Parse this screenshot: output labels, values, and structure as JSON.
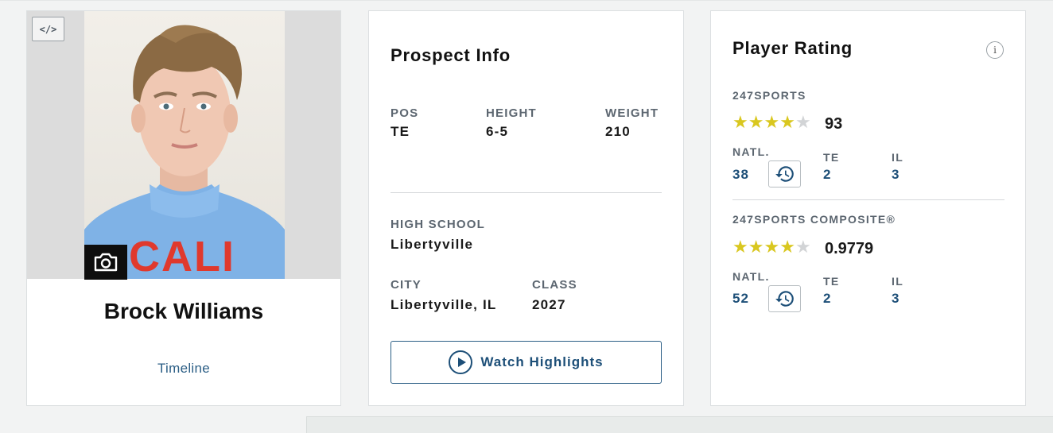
{
  "profile": {
    "name": "Brock Williams",
    "timeline_label": "Timeline",
    "embed_label": "</>",
    "jersey_text": "CALI"
  },
  "prospect": {
    "title": "Prospect Info",
    "pos_label": "POS",
    "pos_value": "TE",
    "height_label": "HEIGHT",
    "height_value": "6-5",
    "weight_label": "WEIGHT",
    "weight_value": "210",
    "school_label": "HIGH SCHOOL",
    "school_value": "Libertyville",
    "city_label": "CITY",
    "city_value": "Libertyville, IL",
    "class_label": "CLASS",
    "class_value": "2027",
    "watch_label": "Watch Highlights"
  },
  "rating": {
    "title": "Player Rating",
    "info_label": "i",
    "sports247": {
      "label": "247SPORTS",
      "stars": 4,
      "max_stars": 5,
      "score": "93",
      "natl_label": "NATL.",
      "natl_value": "38",
      "pos_label": "TE",
      "pos_value": "2",
      "state_label": "IL",
      "state_value": "3"
    },
    "composite": {
      "label": "247SPORTS COMPOSITE®",
      "stars": 4,
      "max_stars": 5,
      "score": "0.9779",
      "natl_label": "NATL.",
      "natl_value": "52",
      "pos_label": "TE",
      "pos_value": "2",
      "state_label": "IL",
      "state_value": "3"
    }
  },
  "colors": {
    "accent_blue": "#1d4f78",
    "star_gold": "#d9c71f",
    "star_empty": "#d2d4d6",
    "jersey_blue": "#7fb2e6",
    "jersey_red": "#e0392d"
  },
  "icons": [
    "embed-code-icon",
    "camera-icon",
    "play-circle-icon",
    "info-icon",
    "history-icon"
  ]
}
